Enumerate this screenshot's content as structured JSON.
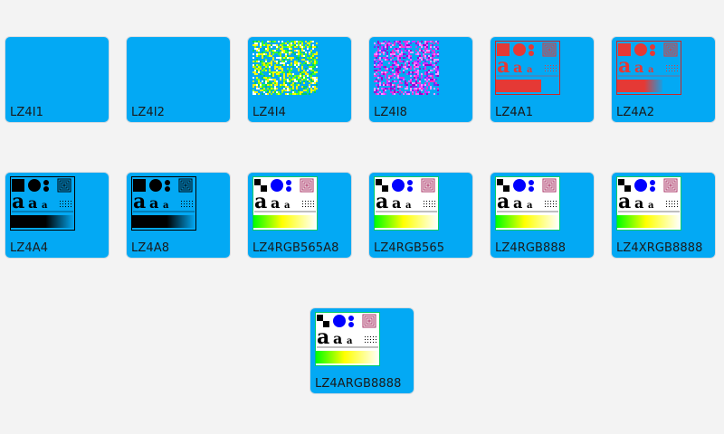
{
  "tiles": [
    {
      "label": "LZ4I1",
      "thumb": "blank"
    },
    {
      "label": "LZ4I2",
      "thumb": "blank"
    },
    {
      "label": "LZ4I4",
      "thumb": "noise-yellow-green"
    },
    {
      "label": "LZ4I8",
      "thumb": "noise-purple-pink"
    },
    {
      "label": "LZ4A1",
      "thumb": "testpattern-red"
    },
    {
      "label": "LZ4A2",
      "thumb": "testpattern-red-gradient"
    },
    {
      "label": "LZ4A4",
      "thumb": "testpattern-black"
    },
    {
      "label": "LZ4A8",
      "thumb": "testpattern-black"
    },
    {
      "label": "LZ4RGB565A8",
      "thumb": "testpattern-color"
    },
    {
      "label": "LZ4RGB565",
      "thumb": "testpattern-color"
    },
    {
      "label": "LZ4RGB888",
      "thumb": "testpattern-color"
    },
    {
      "label": "LZ4XRGB8888",
      "thumb": "testpattern-color"
    },
    {
      "label": "LZ4ARGB8888",
      "thumb": "testpattern-color"
    }
  ],
  "colors": {
    "tile_bg": "#03a9f4",
    "page_bg": "#f3f3f3",
    "pattern_red": "#e53935",
    "pattern_blue": "#0000ff"
  }
}
